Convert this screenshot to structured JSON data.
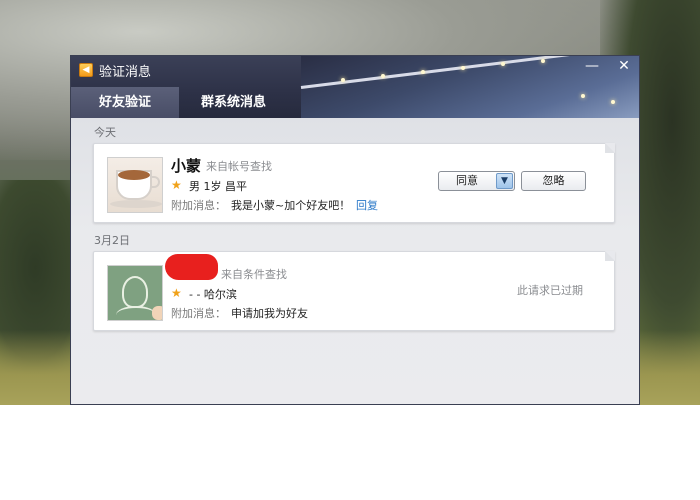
{
  "window": {
    "title": "验证消息",
    "minimize_label": "—",
    "close_label": "✕"
  },
  "tabs": [
    {
      "label": "好友验证",
      "active": true
    },
    {
      "label": "群系统消息",
      "active": false
    }
  ],
  "sections": [
    {
      "label": "今天",
      "requests": [
        {
          "name": "小蒙",
          "source": "来自帐号查找",
          "info": "男 1岁 昌平",
          "message_label": "附加消息：",
          "message": "我是小蒙~加个好友吧！",
          "reply_link": "回复",
          "agree_label": "同意",
          "ignore_label": "忽略"
        }
      ]
    },
    {
      "label": "3月2日",
      "requests": [
        {
          "name": "",
          "source": "来自条件查找",
          "info": "- - 哈尔滨",
          "message_label": "附加消息：",
          "message": "申请加我为好友",
          "status": "此请求已过期"
        }
      ]
    }
  ],
  "colors": {
    "header_bg": "#2d3147",
    "link": "#2a78c8",
    "star": "#f0a21a",
    "redaction": "#e8201e"
  },
  "icons": [
    "speaker-icon",
    "minimize-icon",
    "close-icon",
    "star-icon",
    "dropdown-arrow-icon"
  ]
}
